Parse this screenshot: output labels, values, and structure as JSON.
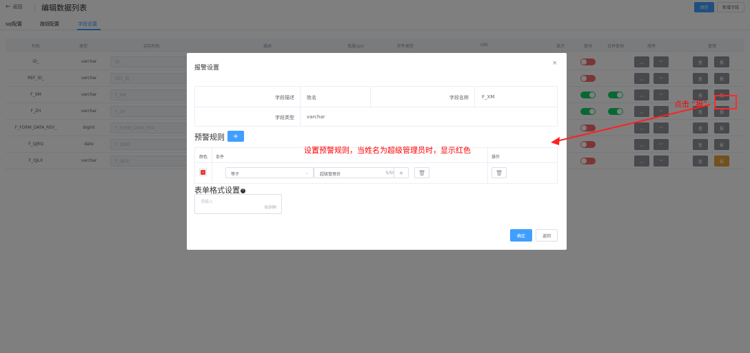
{
  "header": {
    "back_label": "返回",
    "title": "编辑数据列表",
    "save_label": "保存",
    "add_field_label": "新增字段"
  },
  "tabs": [
    {
      "label": "sql配置",
      "active": false
    },
    {
      "label": "按钮配置",
      "active": false
    },
    {
      "label": "字段设置",
      "active": true
    }
  ],
  "table": {
    "headers": [
      "列名",
      "类型",
      "实际列名",
      "描述",
      "宽度(px)",
      "控件类型",
      "URL",
      "显示",
      "查询",
      "合并查询",
      "排序",
      "管理"
    ],
    "rows": [
      {
        "name": "ID_",
        "type": "varchar",
        "real": "ID_",
        "query_on": false,
        "merge_on": null,
        "warn": false
      },
      {
        "name": "REF_ID_",
        "type": "varchar",
        "real": "REF_ID_",
        "query_on": false,
        "merge_on": null,
        "warn": false
      },
      {
        "name": "F_XM",
        "type": "varchar",
        "real": "F_XM",
        "query_on": true,
        "merge_on": true,
        "warn": false
      },
      {
        "name": "F_ZH",
        "type": "varchar",
        "real": "F_ZH",
        "query_on": true,
        "merge_on": true,
        "warn": false
      },
      {
        "name": "F_FORM_DATA_REV_",
        "type": "bigint",
        "real": "F_FORM_DATA_REV_",
        "query_on": false,
        "merge_on": null,
        "warn": false
      },
      {
        "name": "F_QJRQ",
        "type": "date",
        "real": "F_QJRQ",
        "query_on": false,
        "merge_on": null,
        "warn": false
      },
      {
        "name": "F_QJLX",
        "type": "varchar",
        "real": "F_QJLX",
        "query_on": false,
        "merge_on": null,
        "warn": true
      }
    ],
    "manage_label_1": "查",
    "manage_label_2": "报",
    "sort_up_icon": "chevron-up-icon",
    "sort_down_icon": "chevron-down-icon"
  },
  "modal": {
    "title": "报警设置",
    "field_desc_label": "字段描述",
    "field_desc_value": "姓名",
    "field_name_label": "字段名称",
    "field_name_value": "F_XM",
    "field_type_label": "字段类型",
    "field_type_value": "varchar",
    "rules_title": "预警规则",
    "add_symbol": "+",
    "rules_headers": {
      "color": "颜色",
      "condition": "条件",
      "action": "操作"
    },
    "rule": {
      "color": "#e53935",
      "operator": "等于",
      "value": "超级管理员",
      "count": "5/50"
    },
    "format_title": "表单格式设置",
    "format_placeholder": "请输入",
    "format_count": "0/200",
    "ok_label": "确定",
    "back_label": "返回"
  },
  "annotations": {
    "click_note": "点击 “报”",
    "rule_note": "设置预警规则，当姓名为超级管理员时，显示红色"
  },
  "colors": {
    "primary": "#409eff",
    "switch_on": "#13ce66",
    "switch_off": "#f56c6c",
    "warning": "#e6a23c",
    "annotation": "#ff0000"
  }
}
